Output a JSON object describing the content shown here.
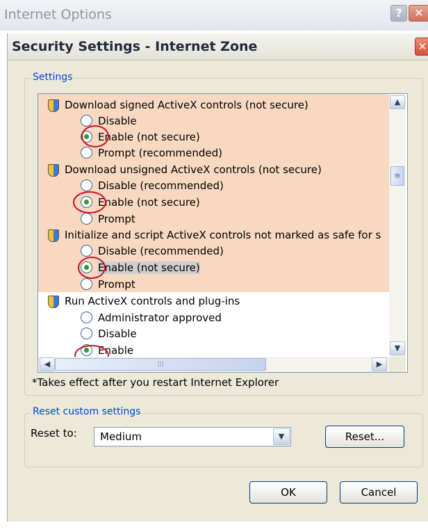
{
  "outer_window": {
    "title": "Internet Options",
    "help_glyph": "?",
    "close_glyph": "✕"
  },
  "dialog": {
    "title": "Security Settings - Internet Zone",
    "close_glyph": "✕"
  },
  "settings_group": {
    "label": "Settings"
  },
  "settings_list": {
    "groups": [
      {
        "header": "Download signed ActiveX controls (not secure)",
        "options": [
          "Disable",
          "Enable (not secure)",
          "Prompt (recommended)"
        ],
        "selected_index": 1
      },
      {
        "header": "Download unsigned ActiveX controls (not secure)",
        "options": [
          "Disable (recommended)",
          "Enable (not secure)",
          "Prompt"
        ],
        "selected_index": 1
      },
      {
        "header": "Initialize and script ActiveX controls not marked as safe for s",
        "options": [
          "Disable (recommended)",
          "Enable (not secure)",
          "Prompt"
        ],
        "selected_index": 1
      },
      {
        "header": "Run ActiveX controls and plug-ins",
        "options": [
          "Administrator approved",
          "Disable",
          "Enable"
        ],
        "selected_index": 2
      }
    ],
    "scroll_up": "▲",
    "scroll_down": "▼",
    "scroll_left": "◀",
    "scroll_right": "▶",
    "scroll_grip": "≡",
    "hscroll_grip": "|||"
  },
  "note": "*Takes effect after you restart Internet Explorer",
  "reset_group": {
    "label": "Reset custom settings",
    "reset_to_label": "Reset to:",
    "reset_to_value": "Medium",
    "dropdown_arrow": "▼",
    "reset_button": "Reset..."
  },
  "buttons": {
    "ok": "OK",
    "cancel": "Cancel"
  },
  "colors": {
    "highlight_band": "#f8d8c0",
    "annotation_circle": "#c8102e",
    "selected_dot": "#22a322",
    "dialog_bg": "#ece9d8"
  },
  "icons": {
    "setting": "shield-icon"
  }
}
